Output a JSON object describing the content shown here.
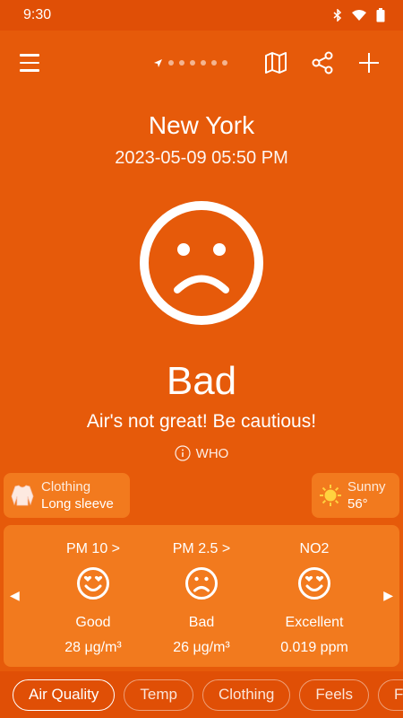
{
  "status_bar": {
    "time": "9:30"
  },
  "app_bar": {
    "icons": [
      "menu-icon",
      "location-arrow-icon",
      "map-icon",
      "share-icon",
      "add-icon"
    ],
    "page_dots": 7
  },
  "location": {
    "city": "New York",
    "datetime": "2023-05-09 05:50 PM"
  },
  "air_quality": {
    "face_icon": "sad-face-icon",
    "status": "Bad",
    "message": "Air's not great! Be cautious!",
    "source": "WHO"
  },
  "clothing": {
    "label": "Clothing",
    "value": "Long sleeve",
    "icon": "long-sleeve-shirt-icon"
  },
  "weather": {
    "label": "Sunny",
    "value": "56°",
    "icon": "sun-icon"
  },
  "pollutants": [
    {
      "name": "PM 10 >",
      "level": "Good",
      "value": "28 μg/m³",
      "icon": "heart-eyes-face-icon"
    },
    {
      "name": "PM 2.5 >",
      "level": "Bad",
      "value": "26 μg/m³",
      "icon": "sad-face-icon"
    },
    {
      "name": "NO2",
      "level": "Excellent",
      "value": "0.019 ppm",
      "icon": "heart-eyes-face-icon"
    }
  ],
  "tabs": [
    {
      "label": "Air Quality",
      "active": true
    },
    {
      "label": "Temp",
      "active": false
    },
    {
      "label": "Clothing",
      "active": false
    },
    {
      "label": "Feels",
      "active": false
    },
    {
      "label": "F",
      "active": false
    }
  ],
  "colors": {
    "background": "#E65A0A",
    "card": "#F27A1E",
    "bar": "#E04F06"
  }
}
